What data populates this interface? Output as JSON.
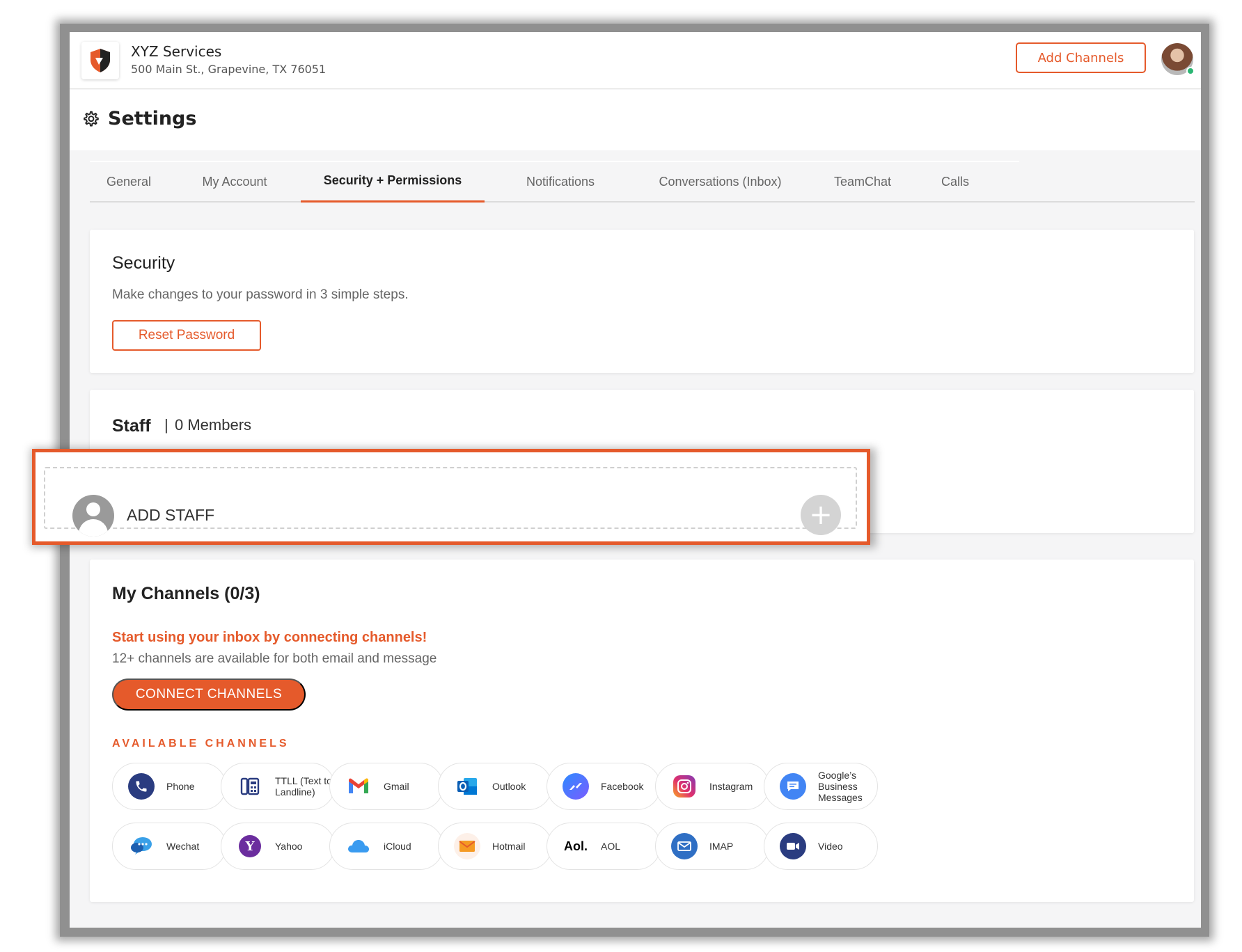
{
  "header": {
    "business_name": "XYZ Services",
    "business_address": "500 Main St., Grapevine, TX 76051",
    "add_channels_label": "Add Channels"
  },
  "settings": {
    "title": "Settings"
  },
  "tabs": [
    {
      "label": "General"
    },
    {
      "label": "My Account"
    },
    {
      "label": "Security + Permissions",
      "active": true
    },
    {
      "label": "Notifications"
    },
    {
      "label": "Conversations (Inbox)"
    },
    {
      "label": "TeamChat"
    },
    {
      "label": "Calls"
    }
  ],
  "security": {
    "title": "Security",
    "description": "Make changes to your password in 3 simple steps.",
    "reset_label": "Reset Password"
  },
  "staff": {
    "title": "Staff",
    "separator": "|",
    "members": "0 Members",
    "add_label": "ADD STAFF",
    "plus": "+"
  },
  "channels": {
    "title": "My Channels (0/3)",
    "promo": "Start using your inbox by connecting channels!",
    "subtext": "12+ channels are available for both email and message",
    "connect_label": "CONNECT CHANNELS",
    "available_label": "AVAILABLE CHANNELS",
    "aol_logo": "Aol.",
    "items": [
      {
        "label": "Phone",
        "icon": "phone-icon"
      },
      {
        "label": "TTLL (Text to Landline)",
        "icon": "landline-icon"
      },
      {
        "label": "Gmail",
        "icon": "gmail-icon"
      },
      {
        "label": "Outlook",
        "icon": "outlook-icon"
      },
      {
        "label": "Facebook",
        "icon": "messenger-icon"
      },
      {
        "label": "Instagram",
        "icon": "instagram-icon"
      },
      {
        "label": "Google’s Business Messages",
        "icon": "google-business-messages-icon"
      },
      {
        "label": "Wechat",
        "icon": "wechat-icon"
      },
      {
        "label": "Yahoo",
        "icon": "yahoo-icon"
      },
      {
        "label": "iCloud",
        "icon": "icloud-icon"
      },
      {
        "label": "Hotmail",
        "icon": "hotmail-icon"
      },
      {
        "label": "AOL",
        "icon": "aol-icon"
      },
      {
        "label": "IMAP",
        "icon": "imap-icon"
      },
      {
        "label": "Video",
        "icon": "video-icon"
      }
    ]
  },
  "colors": {
    "accent": "#e55a2b",
    "background": "#f5f5f6",
    "online": "#2bb673"
  }
}
